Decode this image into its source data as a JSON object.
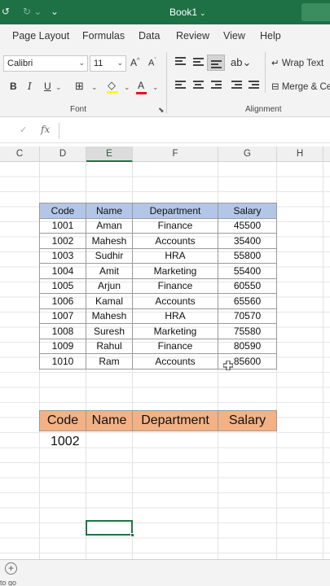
{
  "titlebar": {
    "title": "Book1",
    "colors": {
      "bar": "#1e7145"
    }
  },
  "ribbon_tabs": [
    "Page Layout",
    "Formulas",
    "Data",
    "Review",
    "View",
    "Help"
  ],
  "ribbon": {
    "font_name": "Calibri",
    "font_size": "11",
    "grow_font": "A",
    "shrink_font": "A",
    "bold": "B",
    "italic": "I",
    "underline": "U",
    "font_color_letter": "A",
    "wrap_text": "Wrap Text",
    "merge": "Merge & Ce",
    "font_group": "Font",
    "alignment_group": "Alignment"
  },
  "formula_bar": {
    "cancel": "✓",
    "fx": "fx"
  },
  "columns": [
    "C",
    "D",
    "E",
    "F",
    "G",
    "H"
  ],
  "table": {
    "headers": [
      "Code",
      "Name",
      "Department",
      "Salary"
    ],
    "rows": [
      [
        "1001",
        "Aman",
        "Finance",
        "45500"
      ],
      [
        "1002",
        "Mahesh",
        "Accounts",
        "35400"
      ],
      [
        "1003",
        "Sudhir",
        "HRA",
        "55800"
      ],
      [
        "1004",
        "Amit",
        "Marketing",
        "55400"
      ],
      [
        "1005",
        "Arjun",
        "Finance",
        "60550"
      ],
      [
        "1006",
        "Kamal",
        "Accounts",
        "65560"
      ],
      [
        "1007",
        "Mahesh",
        "HRA",
        "70570"
      ],
      [
        "1008",
        "Suresh",
        "Marketing",
        "75580"
      ],
      [
        "1009",
        "Rahul",
        "Finance",
        "80590"
      ],
      [
        "1010",
        "Ram",
        "Accounts",
        "85600"
      ]
    ],
    "header_color": "#b4c6e7"
  },
  "lookup": {
    "headers": [
      "Code",
      "Name",
      "Department",
      "Salary"
    ],
    "value": "1002",
    "header_color": "#f4b183"
  },
  "status": {
    "text": "to go"
  }
}
